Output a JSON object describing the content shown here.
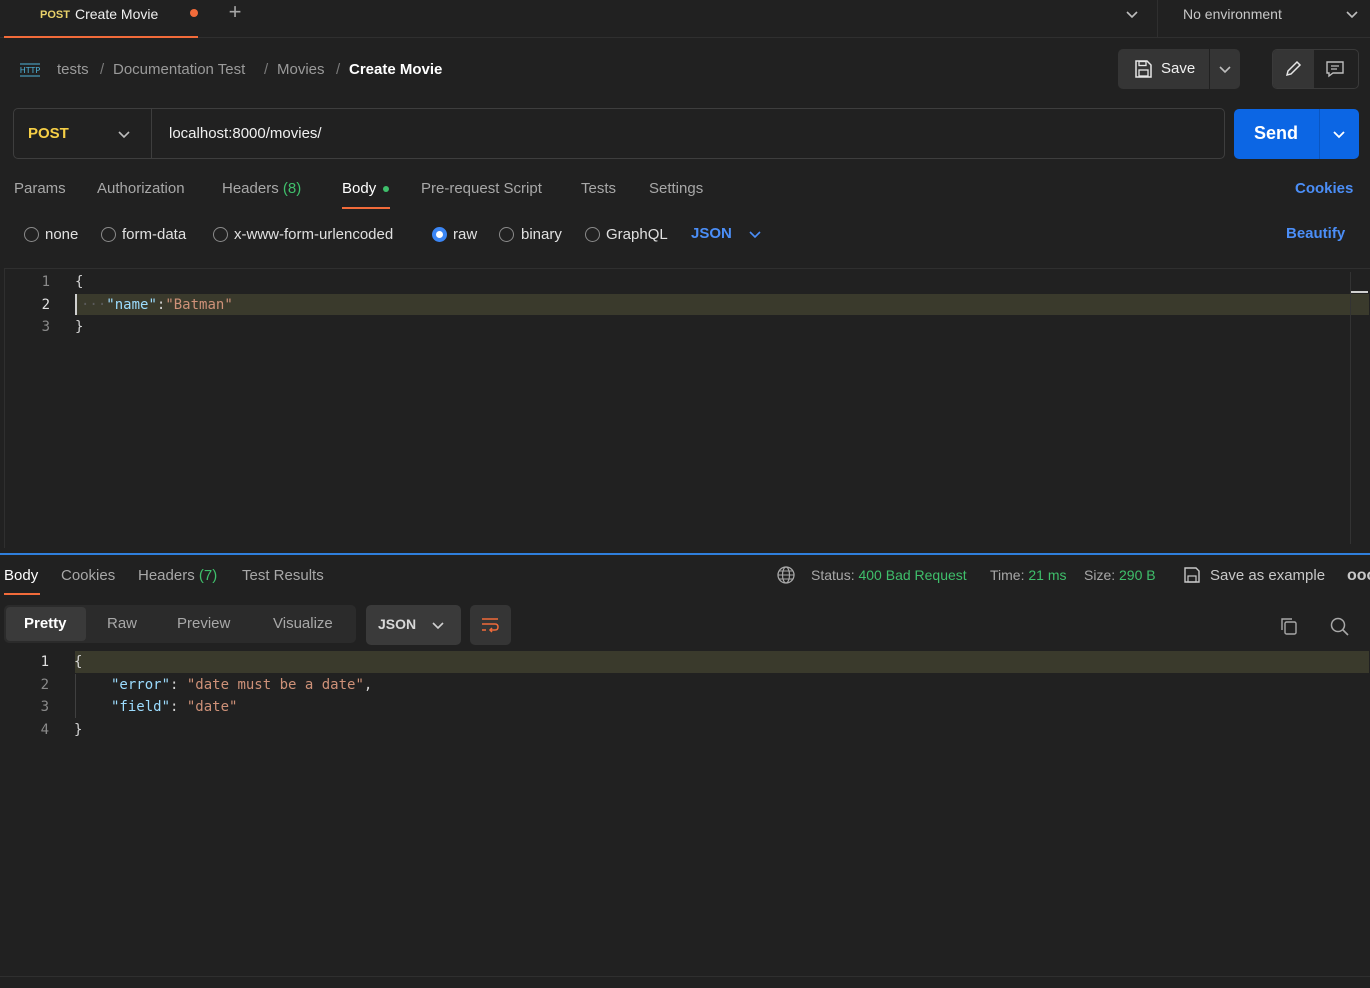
{
  "tab": {
    "method": "POST",
    "name": "Create Movie"
  },
  "environment": {
    "label": "No environment"
  },
  "breadcrumb": {
    "items": [
      "tests",
      "Documentation Test",
      "Movies"
    ],
    "current": "Create Movie",
    "separator": "/"
  },
  "toolbar": {
    "save_label": "Save"
  },
  "request": {
    "method": "POST",
    "url": "localhost:8000/movies/",
    "send_label": "Send"
  },
  "request_tabs": {
    "params": "Params",
    "authorization": "Authorization",
    "headers": "Headers",
    "headers_count": "(8)",
    "body": "Body",
    "prerequest": "Pre-request Script",
    "tests": "Tests",
    "settings": "Settings",
    "cookies": "Cookies"
  },
  "body_types": {
    "none": "none",
    "form_data": "form-data",
    "urlencoded": "x-www-form-urlencoded",
    "raw": "raw",
    "binary": "binary",
    "graphql": "GraphQL",
    "selected": "raw",
    "language": "JSON",
    "beautify": "Beautify"
  },
  "request_body": {
    "line_numbers": [
      "1",
      "2",
      "3"
    ],
    "open": "{",
    "key": "\"name\"",
    "colon": ":",
    "value": "\"Batman\"",
    "close": "}"
  },
  "response_tabs": {
    "body": "Body",
    "cookies": "Cookies",
    "headers": "Headers",
    "headers_count": "(7)",
    "test_results": "Test Results"
  },
  "response_meta": {
    "status_label": "Status:",
    "status_value": "400 Bad Request",
    "time_label": "Time:",
    "time_value": "21 ms",
    "size_label": "Size:",
    "size_value": "290 B",
    "save_example": "Save as example",
    "more": "ooo"
  },
  "view_modes": {
    "pretty": "Pretty",
    "raw": "Raw",
    "preview": "Preview",
    "visualize": "Visualize",
    "format": "JSON"
  },
  "response_body": {
    "line_numbers": [
      "1",
      "2",
      "3",
      "4"
    ],
    "open": "{",
    "key1": "\"error\"",
    "value1": "\"date must be a date\"",
    "key2": "\"field\"",
    "value2": "\"date\"",
    "close": "}"
  },
  "colors": {
    "accent_orange": "#f26b3a",
    "primary_blue": "#0c66e4",
    "link_blue": "#4b8ef7",
    "method_yellow": "#f6cf46",
    "success_green": "#3fbf6b"
  }
}
